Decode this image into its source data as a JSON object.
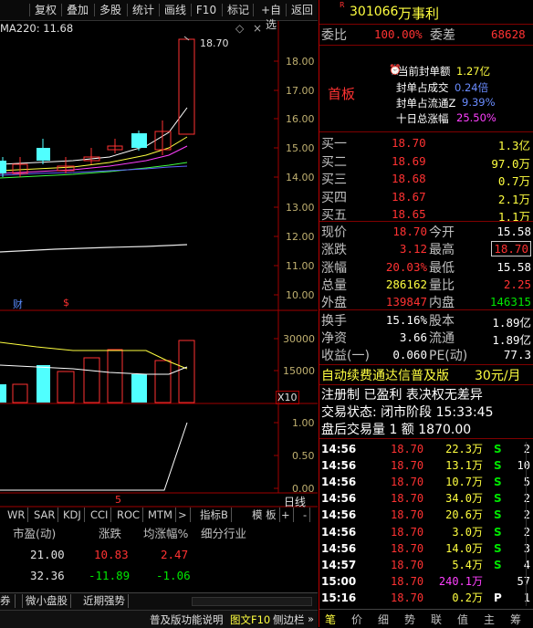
{
  "toolbar": {
    "buttons": [
      "复权",
      "叠加",
      "多股",
      "统计",
      "画线",
      "F10",
      "标记",
      "+自选",
      "返回"
    ]
  },
  "chart": {
    "ma_label": "MA220: 11.68",
    "high_price_label": "18.70",
    "y_ticks": [
      "18.00",
      "17.00",
      "16.00",
      "15.00",
      "14.00",
      "13.00",
      "12.00",
      "11.00",
      "10.00"
    ],
    "vol_ticks": [
      "30000",
      "15000"
    ],
    "vol_unit": "X10",
    "ind_ticks": [
      "1.00",
      "0.50",
      "0.00"
    ],
    "marker_cai": "财",
    "marker_dollar": "$",
    "period_num": "5",
    "period_label": "日线"
  },
  "indicator_tabs": [
    "WR",
    "SAR",
    "KDJ",
    "CCI",
    "ROC",
    "MTM",
    ">",
    "指标B",
    "模 板",
    "+",
    "-"
  ],
  "bottom_table": {
    "headers": [
      "市盈(动)",
      "涨跌",
      "均涨幅%",
      "细分行业"
    ],
    "rows": [
      {
        "pe": "21.00",
        "chg": "10.83",
        "avg": "2.47"
      },
      {
        "pe": "32.36",
        "chg": "-11.89",
        "avg": "-1.06"
      }
    ]
  },
  "bottom_tabs": [
    "券",
    "微小盘股",
    "近期强势"
  ],
  "status_bar": {
    "help": "普及版功能说明",
    "f10": "图文F10",
    "sidebar": "侧边栏"
  },
  "quote": {
    "r_mark": "R",
    "code": "301066",
    "name": "万事利",
    "webi_label": "委比",
    "webi_value": "100.00%",
    "wecha_label": "委差",
    "wecha_value": "68628",
    "shouban": "首板",
    "seal_rows": [
      {
        "label": "当前封单额",
        "value": "1.27亿"
      },
      {
        "label": "封单占成交",
        "value": "0.24倍"
      },
      {
        "label": "封单占流通Z",
        "value": "9.39%"
      },
      {
        "label": "十日总涨幅",
        "value": "25.50%"
      }
    ],
    "bids": [
      {
        "label": "买一",
        "price": "18.70",
        "vol": "1.3亿"
      },
      {
        "label": "买二",
        "price": "18.69",
        "vol": "97.0万"
      },
      {
        "label": "买三",
        "price": "18.68",
        "vol": "0.7万"
      },
      {
        "label": "买四",
        "price": "18.67",
        "vol": "2.1万"
      },
      {
        "label": "买五",
        "price": "18.65",
        "vol": "1.1万"
      }
    ],
    "stats": [
      {
        "l1": "现价",
        "v1": "18.70",
        "l2": "今开",
        "v2": "15.58"
      },
      {
        "l1": "涨跌",
        "v1": "3.12",
        "l2": "最高",
        "v2": "18.70"
      },
      {
        "l1": "涨幅",
        "v1": "20.03%",
        "l2": "最低",
        "v2": "15.58"
      },
      {
        "l1": "总量",
        "v1": "286162",
        "l2": "量比",
        "v2": "2.25"
      },
      {
        "l1": "外盘",
        "v1": "139847",
        "l2": "内盘",
        "v2": "146315"
      }
    ],
    "stats2": [
      {
        "l1": "换手",
        "v1": "15.16%",
        "l2": "股本",
        "v2": "1.89亿"
      },
      {
        "l1": "净资",
        "v1": "3.66",
        "l2": "流通",
        "v2": "1.89亿"
      },
      {
        "l1": "收益(一)",
        "v1": "0.060",
        "l2": "PE(动)",
        "v2": "77.3"
      }
    ],
    "ad_text": "自动续费通达信普及版",
    "ad_price": "30元/月",
    "reg_line": "注册制 已盈利 表决权无差异",
    "trade_status": "交易状态: 闭市阶段 15:33:45",
    "after_hours": "盘后交易量 1 额 1870.00",
    "ticks": [
      {
        "t": "14:56",
        "p": "18.70",
        "v": "22.3万",
        "s": "S",
        "n": "2"
      },
      {
        "t": "14:56",
        "p": "18.70",
        "v": "13.1万",
        "s": "S",
        "n": "10"
      },
      {
        "t": "14:56",
        "p": "18.70",
        "v": "10.7万",
        "s": "S",
        "n": "5"
      },
      {
        "t": "14:56",
        "p": "18.70",
        "v": "34.0万",
        "s": "S",
        "n": "2"
      },
      {
        "t": "14:56",
        "p": "18.70",
        "v": "20.6万",
        "s": "S",
        "n": "2"
      },
      {
        "t": "14:56",
        "p": "18.70",
        "v": "3.0万",
        "s": "S",
        "n": "2"
      },
      {
        "t": "14:56",
        "p": "18.70",
        "v": "14.0万",
        "s": "S",
        "n": "3"
      },
      {
        "t": "14:57",
        "p": "18.70",
        "v": "5.4万",
        "s": "S",
        "n": "4"
      },
      {
        "t": "15:00",
        "p": "18.70",
        "v": "240.1万",
        "s": "",
        "n": "57"
      },
      {
        "t": "15:16",
        "p": "18.70",
        "v": "0.2万",
        "s": "P",
        "n": "1"
      }
    ],
    "bottom_tabs": [
      "笔",
      "价",
      "细",
      "势",
      "联",
      "值",
      "主",
      "筹"
    ]
  }
}
